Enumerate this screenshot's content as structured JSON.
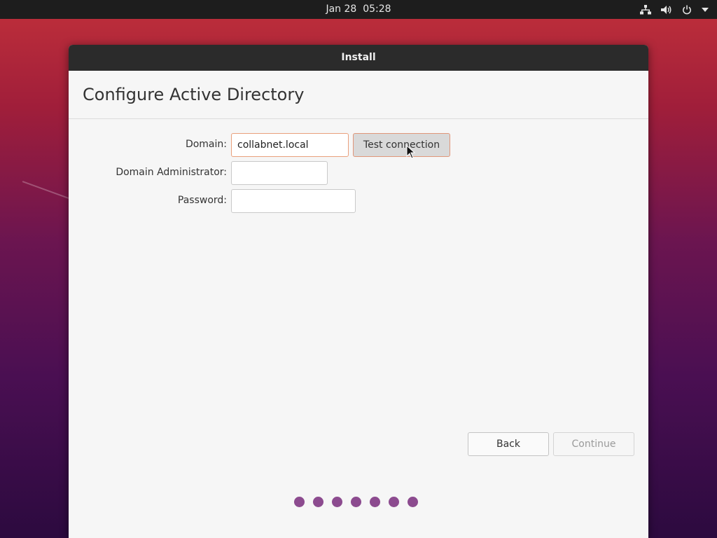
{
  "topbar": {
    "date": "Jan 28",
    "time": "05:28",
    "icons": [
      "network-icon",
      "volume-icon",
      "power-icon",
      "menu-arrow-icon"
    ]
  },
  "window": {
    "title": "Install",
    "page_title": "Configure Active Directory"
  },
  "form": {
    "domain_label": "Domain:",
    "domain_value": "collabnet.local",
    "admin_label": "Domain Administrator:",
    "admin_value": "",
    "password_label": "Password:",
    "password_value": "",
    "test_connection_label": "Test connection"
  },
  "footer": {
    "back_label": "Back",
    "continue_label": "Continue"
  },
  "progress": {
    "total_steps": 7
  },
  "colors": {
    "dot": "#8c4b8f",
    "focus_border": "#e9a07c"
  }
}
